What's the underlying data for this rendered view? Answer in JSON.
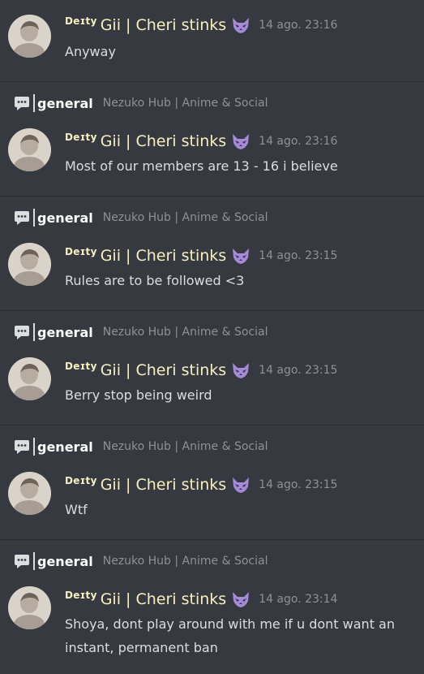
{
  "colors": {
    "background": "#36393f",
    "username": "#f6f0c0",
    "channel": "#ffffff",
    "muted": "#8e9297",
    "message": "#dcddde"
  },
  "user": {
    "role_tag": "Deɪty",
    "name": "Gii | Cheri stinks",
    "emoji": "purple-fox-mask-emoji"
  },
  "results": [
    {
      "channel": "",
      "server": "",
      "timestamp": "14 ago. 23:16",
      "text": "Anyway"
    },
    {
      "channel": "general",
      "server": "Nezuko Hub | Anime & Social",
      "timestamp": "14 ago. 23:16",
      "text": "Most of our members are 13 - 16 i believe"
    },
    {
      "channel": "general",
      "server": "Nezuko Hub | Anime & Social",
      "timestamp": "14 ago. 23:15",
      "text": "Rules are to be followed <3"
    },
    {
      "channel": "general",
      "server": "Nezuko Hub | Anime & Social",
      "timestamp": "14 ago. 23:15",
      "text": "Berry stop being weird"
    },
    {
      "channel": "general",
      "server": "Nezuko Hub | Anime & Social",
      "timestamp": "14 ago. 23:15",
      "text": "Wtf"
    },
    {
      "channel": "general",
      "server": "Nezuko Hub | Anime & Social",
      "timestamp": "14 ago. 23:14",
      "text": "Shoya, dont play around with me if u dont want an instant, permanent ban"
    }
  ]
}
